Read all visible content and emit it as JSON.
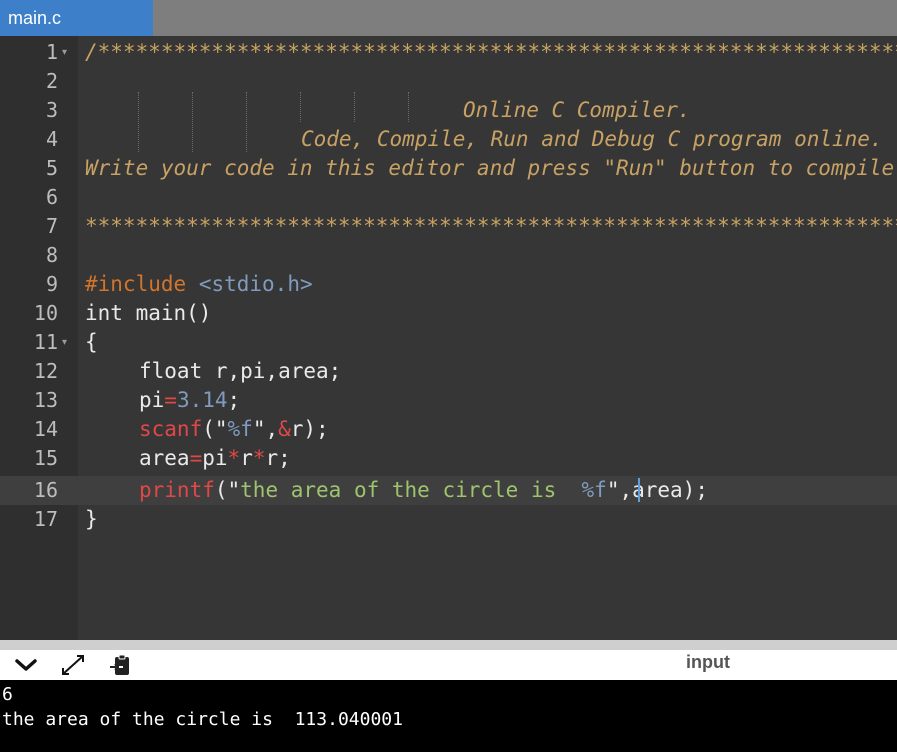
{
  "tab": {
    "filename": "main.c"
  },
  "editor": {
    "line_numbers": [
      "1",
      "2",
      "3",
      "4",
      "5",
      "6",
      "7",
      "8",
      "9",
      "10",
      "11",
      "12",
      "13",
      "14",
      "15",
      "16",
      "17"
    ],
    "fold_markers": {
      "line1": "▾",
      "line11": "▾"
    },
    "lines": {
      "l1": "/******************************************************************",
      "l3": "Online C Compiler.",
      "l4": "Code, Compile, Run and Debug C program online.",
      "l5": "Write your code in this editor and press \"Run\" button to compile and execute it.",
      "l7": "*******************************************************************",
      "l9_pp": "#include",
      "l9_hdr": "<stdio.h>",
      "l10": "int main()",
      "l11": "{",
      "l12": "float r,pi,area;",
      "l13_a": "pi",
      "l13_op": "=",
      "l13_num": "3.14",
      "l13_b": ";",
      "l14_fn": "scanf",
      "l14_a": "(\"",
      "l14_fmt": "%f",
      "l14_b": "\",",
      "l14_op": "&",
      "l14_c": "r);",
      "l15_a": "area",
      "l15_op1": "=",
      "l15_b": "pi",
      "l15_op2": "*",
      "l15_c": "r",
      "l15_op3": "*",
      "l15_d": "r;",
      "l16_fn": "printf",
      "l16_a": "(\"",
      "l16_str": "the area of the circle is  ",
      "l16_fmt": "%f",
      "l16_b": "\",area);",
      "l17": "}"
    }
  },
  "toolbar": {
    "collapse_icon": "chevron-down-icon",
    "expand_icon": "expand-icon",
    "copy_icon": "clipboard-icon",
    "input_label": "input"
  },
  "console": {
    "lines": [
      "6",
      "the area of the circle is  113.040001"
    ]
  },
  "colors": {
    "tab_active": "#3d7fc9",
    "editor_bg": "#363636",
    "comment": "#c8a264",
    "preprocessor": "#d1752c",
    "string": "#9ec46e",
    "function": "#e04848"
  }
}
